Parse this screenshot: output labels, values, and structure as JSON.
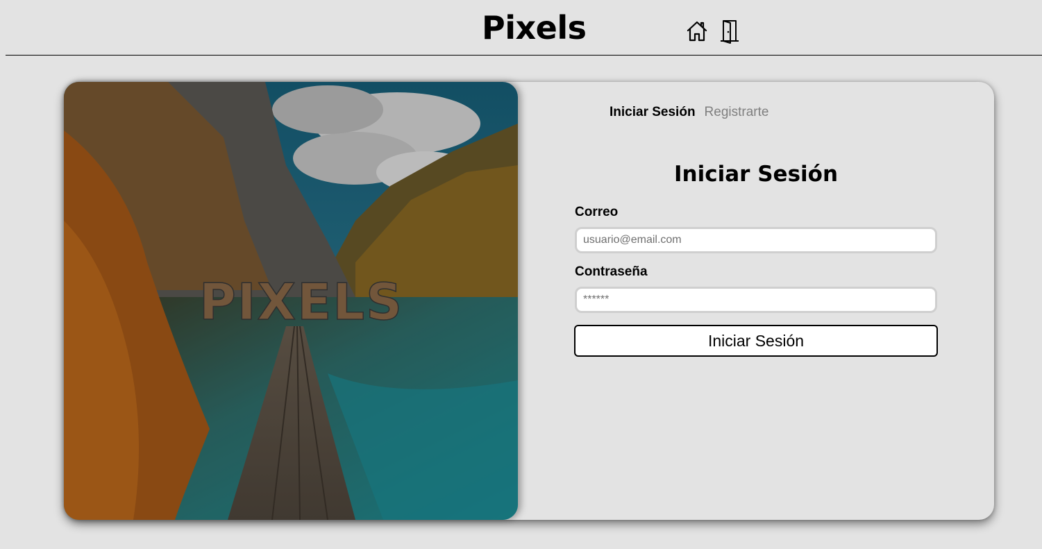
{
  "header": {
    "brand": "Pixels",
    "icons": [
      "home-icon",
      "door-exit-icon"
    ]
  },
  "hero": {
    "image": "mountain-lake-boardwalk-photo",
    "overlay_text": "PIXELS"
  },
  "auth": {
    "tabs": [
      {
        "label": "Iniciar Sesión",
        "active": true
      },
      {
        "label": "Registrarte",
        "active": false
      }
    ],
    "title": "Iniciar Sesión",
    "email": {
      "label": "Correo",
      "placeholder": "usuario@email.com",
      "value": ""
    },
    "password": {
      "label": "Contraseña",
      "placeholder": "******",
      "value": ""
    },
    "submit_label": "Iniciar Sesión"
  },
  "colors": {
    "background": "#e3e3e3",
    "inactive_tab": "#7f7f7f",
    "input_border": "#cfcfcf",
    "text": "#000000"
  }
}
